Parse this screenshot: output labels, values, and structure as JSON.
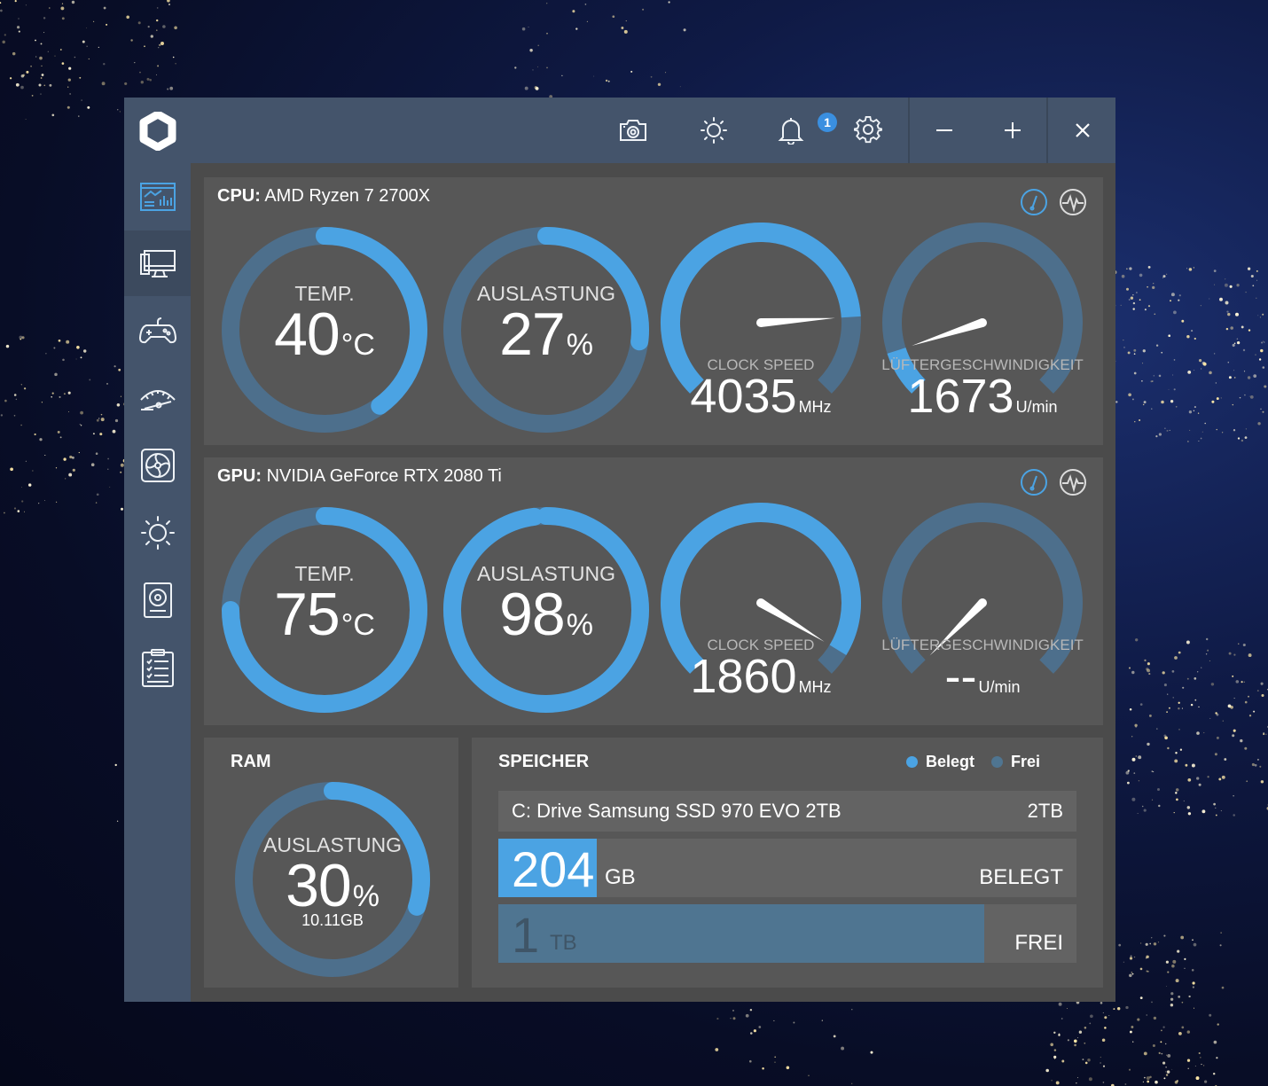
{
  "titlebar": {
    "notification_count": "1"
  },
  "cpu": {
    "title_prefix": "CPU:",
    "title_name": "AMD Ryzen 7 2700X",
    "temp": {
      "label": "TEMP.",
      "value": "40",
      "unit": "°C",
      "fraction": 0.4
    },
    "load": {
      "label": "AUSLASTUNG",
      "value": "27",
      "unit": "%",
      "fraction": 0.27
    },
    "clock": {
      "label": "CLOCK SPEED",
      "value": "4035",
      "unit": "MHz",
      "fraction": 0.82
    },
    "fan": {
      "label": "LÜFTERGESCHWINDIGKEIT",
      "value": "1673",
      "unit": "U/min",
      "fraction": 0.1
    }
  },
  "gpu": {
    "title_prefix": "GPU:",
    "title_name": "NVIDIA GeForce RTX 2080 Ti",
    "temp": {
      "label": "TEMP.",
      "value": "75",
      "unit": "°C",
      "fraction": 0.75
    },
    "load": {
      "label": "AUSLASTUNG",
      "value": "98",
      "unit": "%",
      "fraction": 0.98
    },
    "clock": {
      "label": "CLOCK SPEED",
      "value": "1860",
      "unit": "MHz",
      "fraction": 0.95
    },
    "fan": {
      "label": "LÜFTERGESCHWINDIGKEIT",
      "value": "--",
      "unit": "U/min",
      "fraction": 0.0
    }
  },
  "ram": {
    "title": "RAM",
    "label": "AUSLASTUNG",
    "value": "30",
    "unit": "%",
    "sub": "10.11GB",
    "fraction": 0.3
  },
  "storage": {
    "title": "SPEICHER",
    "legend_used": "Belegt",
    "legend_free": "Frei",
    "drive_name": "C: Drive Samsung SSD 970 EVO 2TB",
    "drive_size": "2TB",
    "used_value": "204",
    "used_unit": "GB",
    "used_label": "BELEGT",
    "used_fraction": 0.17,
    "free_value": "1",
    "free_unit": "TB",
    "free_label": "FREI",
    "free_fraction": 0.84
  },
  "colors": {
    "accent": "#4ba3e3",
    "track": "#4d6f8c",
    "panel": "#575757",
    "app_bg": "#4b4b4b",
    "chrome": "#44546b",
    "free_bar": "#4f7591"
  },
  "icons": {
    "titlebar": [
      "camera-icon",
      "brightness-icon",
      "bell-icon",
      "settings-icon",
      "minimize-icon",
      "maximize-icon",
      "close-icon"
    ],
    "sidebar": [
      "dashboard-icon",
      "monitor-icon",
      "gamepad-icon",
      "speedometer-icon",
      "fan-icon",
      "brightness-icon",
      "hard-drive-icon",
      "checklist-icon"
    ],
    "card": [
      "gauge-view-icon",
      "graph-view-icon"
    ]
  }
}
